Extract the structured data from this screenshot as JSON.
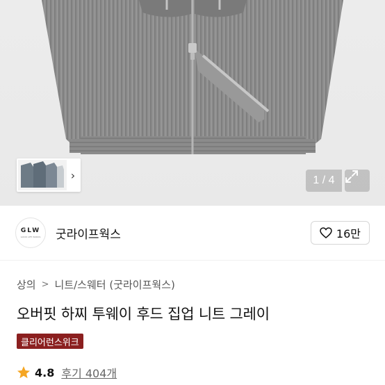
{
  "product_image": {
    "counter": "1 / 4",
    "colors": {
      "background": "#ebebeb",
      "knit": "#8d8d8d"
    }
  },
  "brand": {
    "logo_text": "GLW",
    "logo_subtext": "GOOD LIFE WORKS",
    "name": "굿라이프웍스",
    "likes": "16만"
  },
  "breadcrumb": {
    "items": [
      "상의",
      "니트/스웨터 (굿라이프웍스)"
    ]
  },
  "product": {
    "title": "오버핏 하찌 투웨이 후드 집업 니트 그레이",
    "badge": "클리어런스위크",
    "rating": "4.8",
    "reviews": "후기 404개"
  },
  "colors": {
    "badge_bg": "#8b1f1f",
    "star": "#f5a623"
  }
}
